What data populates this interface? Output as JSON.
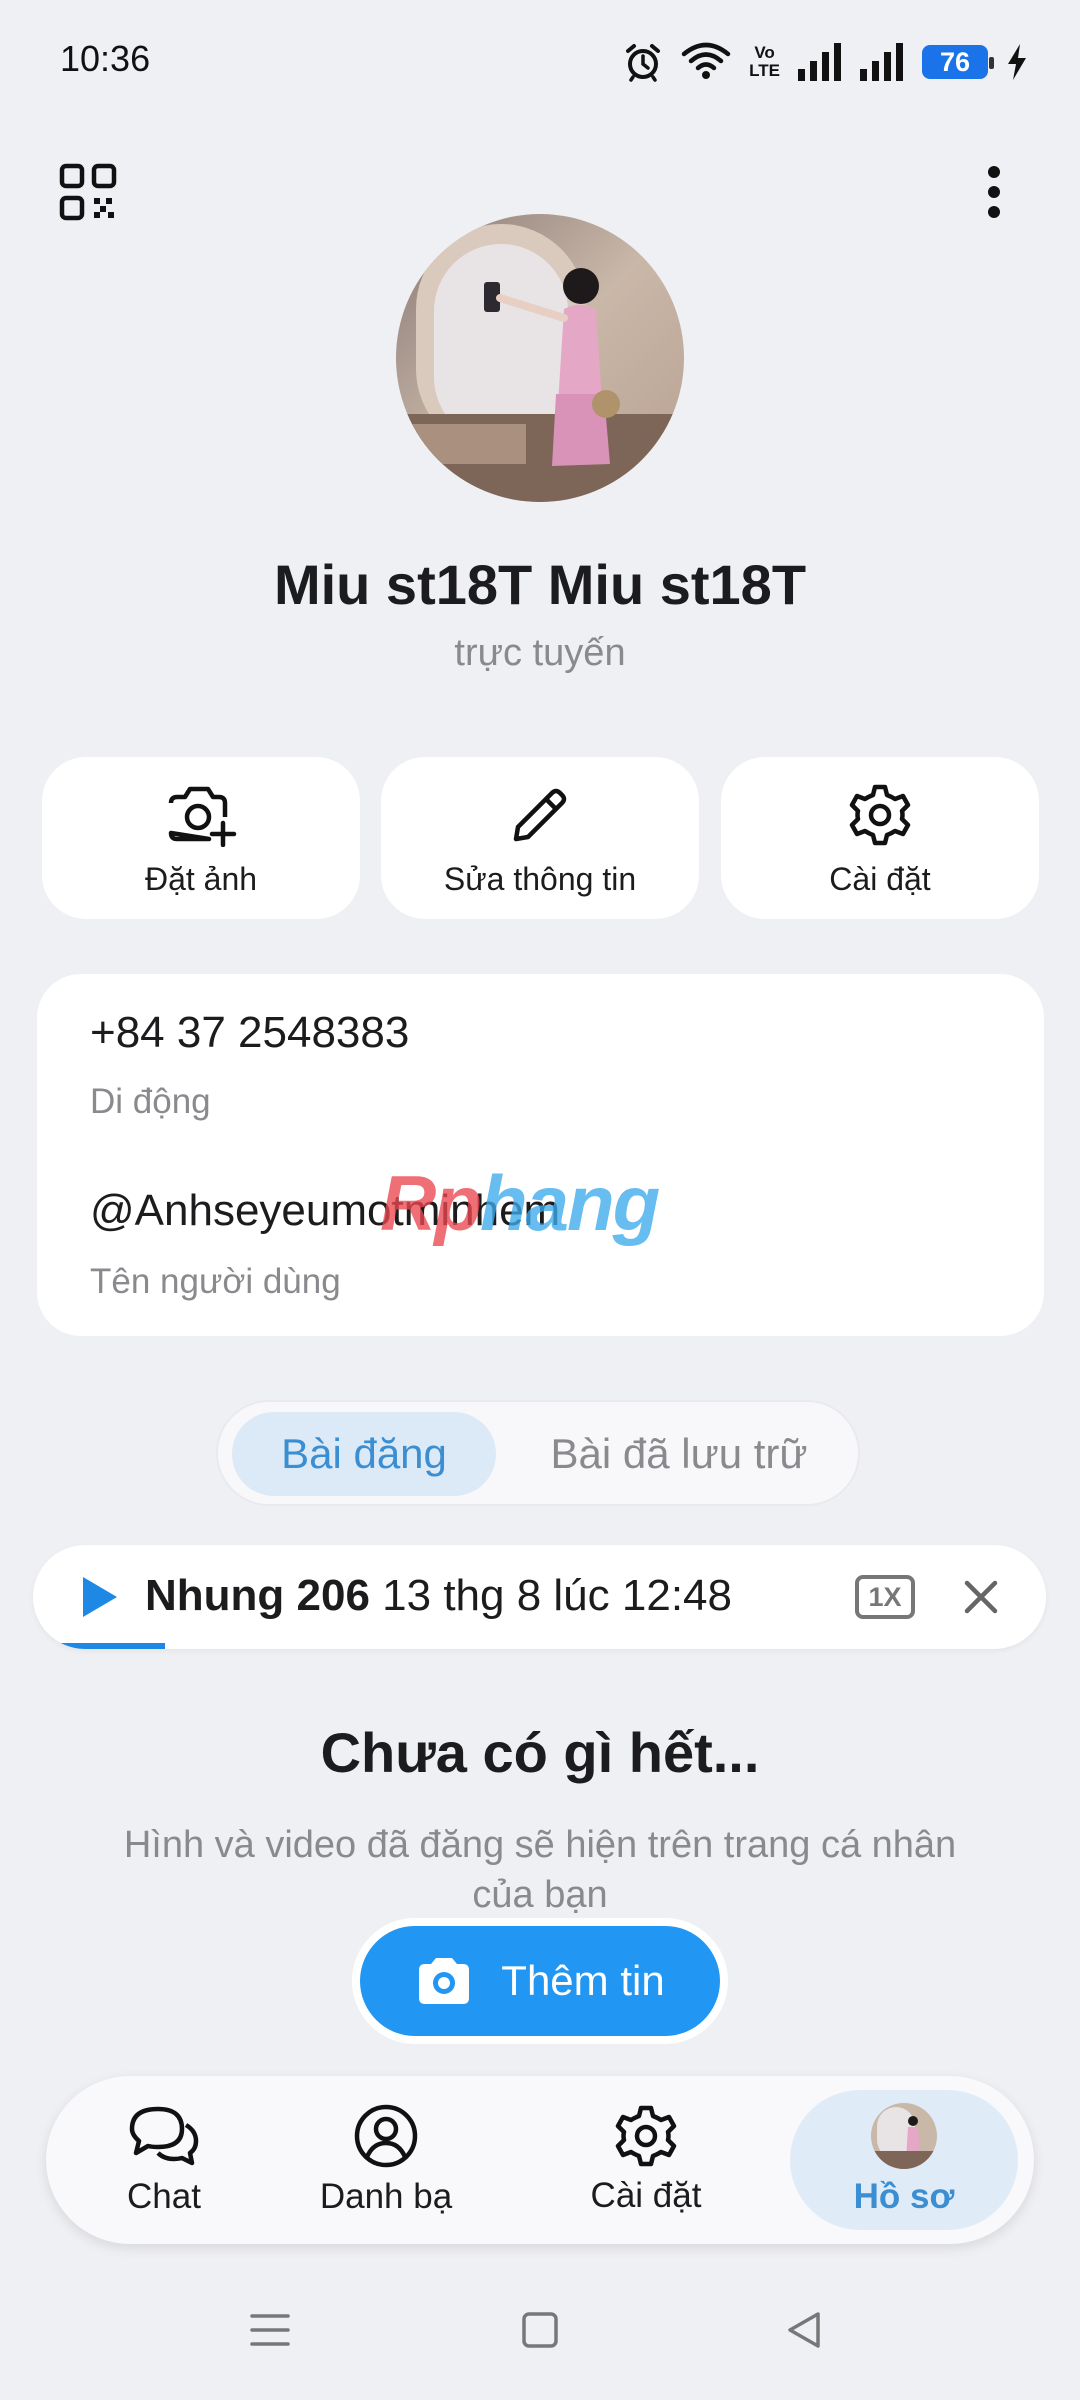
{
  "status_bar": {
    "time": "10:36",
    "network_line1": "Vo",
    "network_line2": "LTE",
    "battery": "76",
    "icons": [
      "alarm-icon",
      "wifi-icon",
      "signal-icon",
      "signal-icon",
      "charging-icon"
    ]
  },
  "header": {
    "left_icon": "qr-code-icon",
    "right_icon": "more-vertical-icon"
  },
  "profile": {
    "name": "Miu st18T Miu st18T",
    "status": "trực tuyến"
  },
  "actions": [
    {
      "label": "Đặt ảnh",
      "icon": "camera-plus-icon"
    },
    {
      "label": "Sửa thông tin",
      "icon": "pencil-icon"
    },
    {
      "label": "Cài đặt",
      "icon": "gear-icon"
    }
  ],
  "info": {
    "phone": "+84 37 2548383",
    "phone_label": "Di động",
    "username": "@Anhseyeumotminhem",
    "username_label": "Tên người dùng",
    "watermark_a": "Rp",
    "watermark_b": "hang"
  },
  "tabs": [
    {
      "label": "Bài đăng",
      "active": true
    },
    {
      "label": "Bài đã lưu trữ",
      "active": false
    }
  ],
  "audio": {
    "title": "Nhung 206",
    "date": "13 thg 8 lúc 12:48",
    "speed": "1X",
    "progress": 0.13
  },
  "empty_state": {
    "title": "Chưa có gì hết...",
    "description": "Hình và video đã đăng sẽ hiện trên trang cá nhân của bạn",
    "button_label": "Thêm tin"
  },
  "bottom_nav": [
    {
      "label": "Chat",
      "icon": "chat-bubbles-icon",
      "active": false
    },
    {
      "label": "Danh bạ",
      "icon": "contact-icon",
      "active": false
    },
    {
      "label": "Cài đặt",
      "icon": "gear-icon",
      "active": false
    },
    {
      "label": "Hồ sơ",
      "icon": "avatar",
      "active": true
    }
  ],
  "colors": {
    "accent": "#2196f3",
    "active_tab_bg": "#dce9f6",
    "background": "#eff0f4"
  }
}
